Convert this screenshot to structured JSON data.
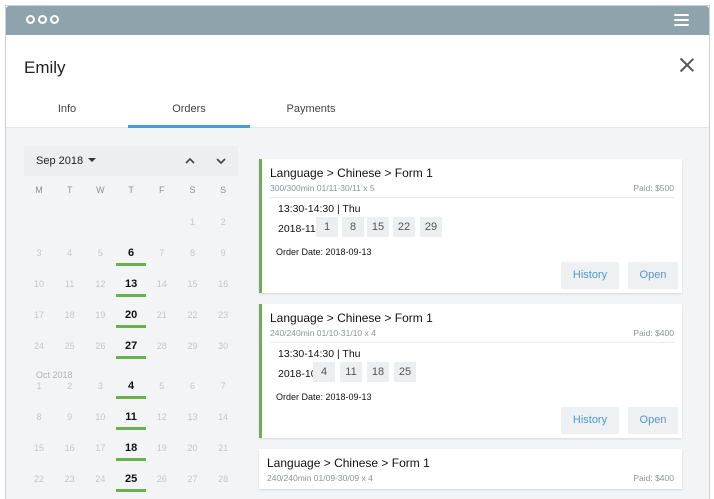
{
  "header": {
    "name": "Emily"
  },
  "tabs": [
    {
      "label": "Info"
    },
    {
      "label": "Orders"
    },
    {
      "label": "Payments"
    }
  ],
  "calendar": {
    "month_label": "Sep 2018",
    "weekdays": [
      "M",
      "T",
      "W",
      "T",
      "F",
      "S",
      "S"
    ],
    "oct_label": "Oct 2018",
    "rows": [
      [
        "",
        "",
        "",
        "",
        "",
        "1",
        "2"
      ],
      [
        "3",
        "4",
        "5",
        "6",
        "7",
        "8",
        "9"
      ],
      [
        "10",
        "11",
        "12",
        "13",
        "14",
        "15",
        "16"
      ],
      [
        "17",
        "18",
        "19",
        "20",
        "21",
        "22",
        "23"
      ],
      [
        "24",
        "25",
        "26",
        "27",
        "28",
        "29",
        "30"
      ],
      [
        "1",
        "2",
        "3",
        "4",
        "5",
        "6",
        "7"
      ],
      [
        "8",
        "9",
        "10",
        "11",
        "12",
        "13",
        "14"
      ],
      [
        "15",
        "16",
        "17",
        "18",
        "19",
        "20",
        "21"
      ],
      [
        "22",
        "23",
        "24",
        "25",
        "26",
        "27",
        "28"
      ]
    ],
    "highlight_column": 3
  },
  "orders": [
    {
      "title": "Language > Chinese > Form 1",
      "subtitle": "300/300min 01/11-30/11 x 5",
      "paid": "Paid: $500",
      "time": "13:30-14:30 | Thu",
      "month": "2018-11",
      "days": [
        "1",
        "8",
        "15",
        "22",
        "29"
      ],
      "order_date": "Order Date: 2018-09-13",
      "history_label": "History",
      "open_label": "Open"
    },
    {
      "title": "Language > Chinese > Form 1",
      "subtitle": "240/240min 01/10-31/10 x 4",
      "paid": "Paid: $400",
      "time": "13:30-14:30 | Thu",
      "month": "2018-10",
      "days": [
        "4",
        "11",
        "18",
        "25"
      ],
      "order_date": "Order Date: 2018-09-13",
      "history_label": "History",
      "open_label": "Open"
    },
    {
      "title": "Language > Chinese > Form 1",
      "subtitle": "240/240min 01/09-30/09 x 4",
      "paid": "Paid: $400"
    }
  ],
  "colors": {
    "titlebar": "#8fa3ad",
    "accent_blue": "#4a9ad8",
    "accent_green": "#6ab04c"
  }
}
